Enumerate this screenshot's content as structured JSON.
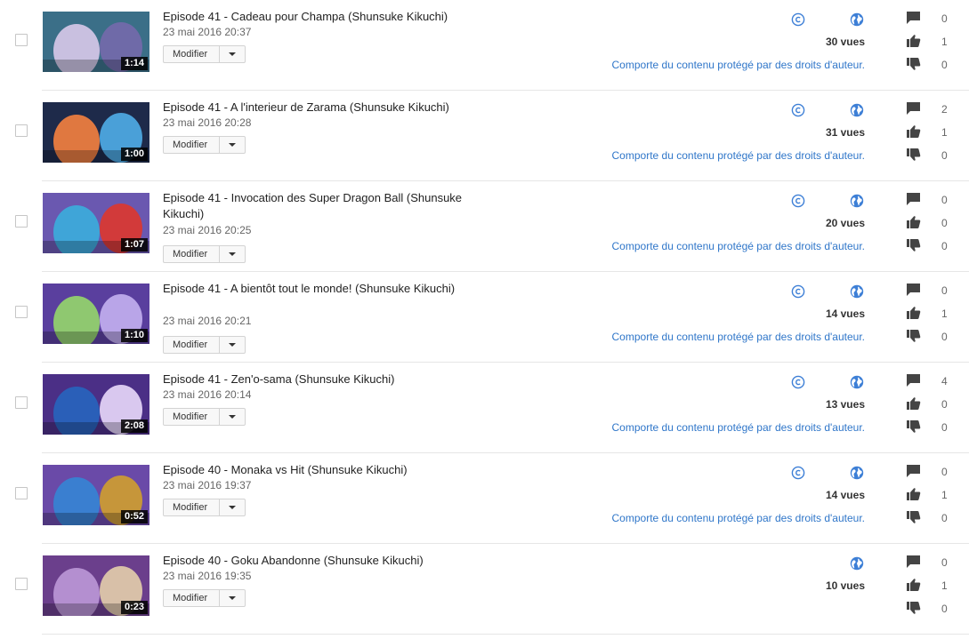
{
  "ui": {
    "edit_label": "Modifier",
    "claim_text": "Comporte du contenu protégé par des droits d'auteur.",
    "accent_blue": "#2f76c9"
  },
  "videos": [
    {
      "title": "Episode 41 - Cadeau pour Champa (Shunsuke Kikuchi)",
      "date": "23 mai 2016 20:37",
      "duration": "1:14",
      "views": "30 vues",
      "comments": "0",
      "likes": "1",
      "dislikes": "0",
      "has_claim": true,
      "thumb_palette": [
        "#3b6f88",
        "#c9c0e0",
        "#6f6aa8"
      ]
    },
    {
      "title": "Episode 41 - A l'interieur de Zarama (Shunsuke Kikuchi)",
      "date": "23 mai 2016 20:28",
      "duration": "1:00",
      "views": "31 vues",
      "comments": "2",
      "likes": "1",
      "dislikes": "0",
      "has_claim": true,
      "thumb_palette": [
        "#1e2a4a",
        "#e07840",
        "#4aa0d8"
      ]
    },
    {
      "title": "Episode 41 - Invocation des Super Dragon Ball (Shunsuke Kikuchi)",
      "date": "23 mai 2016 20:25",
      "duration": "1:07",
      "views": "20 vues",
      "comments": "0",
      "likes": "0",
      "dislikes": "0",
      "has_claim": true,
      "thumb_palette": [
        "#6a58b0",
        "#3fa5d8",
        "#d23a3a"
      ]
    },
    {
      "title": "Episode 41 - A bientôt tout le monde! (Shunsuke Kikuchi)",
      "date": "23 mai 2016 20:21",
      "duration": "1:10",
      "views": "14 vues",
      "comments": "0",
      "likes": "1",
      "dislikes": "0",
      "has_claim": true,
      "thumb_palette": [
        "#5a3f9e",
        "#8fc870",
        "#b9a5e8"
      ]
    },
    {
      "title": "Episode 41 - Zen'o-sama (Shunsuke Kikuchi)",
      "date": "23 mai 2016 20:14",
      "duration": "2:08",
      "views": "13 vues",
      "comments": "4",
      "likes": "0",
      "dislikes": "0",
      "has_claim": true,
      "thumb_palette": [
        "#4b2f86",
        "#2a5fb8",
        "#d9c8ef"
      ]
    },
    {
      "title": "Episode 40 - Monaka vs Hit (Shunsuke Kikuchi)",
      "date": "23 mai 2016 19:37",
      "duration": "0:52",
      "views": "14 vues",
      "comments": "0",
      "likes": "1",
      "dislikes": "0",
      "has_claim": true,
      "thumb_palette": [
        "#6a4aa8",
        "#3a7fd0",
        "#c6963a"
      ]
    },
    {
      "title": "Episode 40 - Goku Abandonne (Shunsuke Kikuchi)",
      "date": "23 mai 2016 19:35",
      "duration": "0:23",
      "views": "10 vues",
      "comments": "0",
      "likes": "1",
      "dislikes": "0",
      "has_claim": false,
      "thumb_palette": [
        "#6b3f8c",
        "#b48fd0",
        "#d8c0a8"
      ]
    }
  ]
}
